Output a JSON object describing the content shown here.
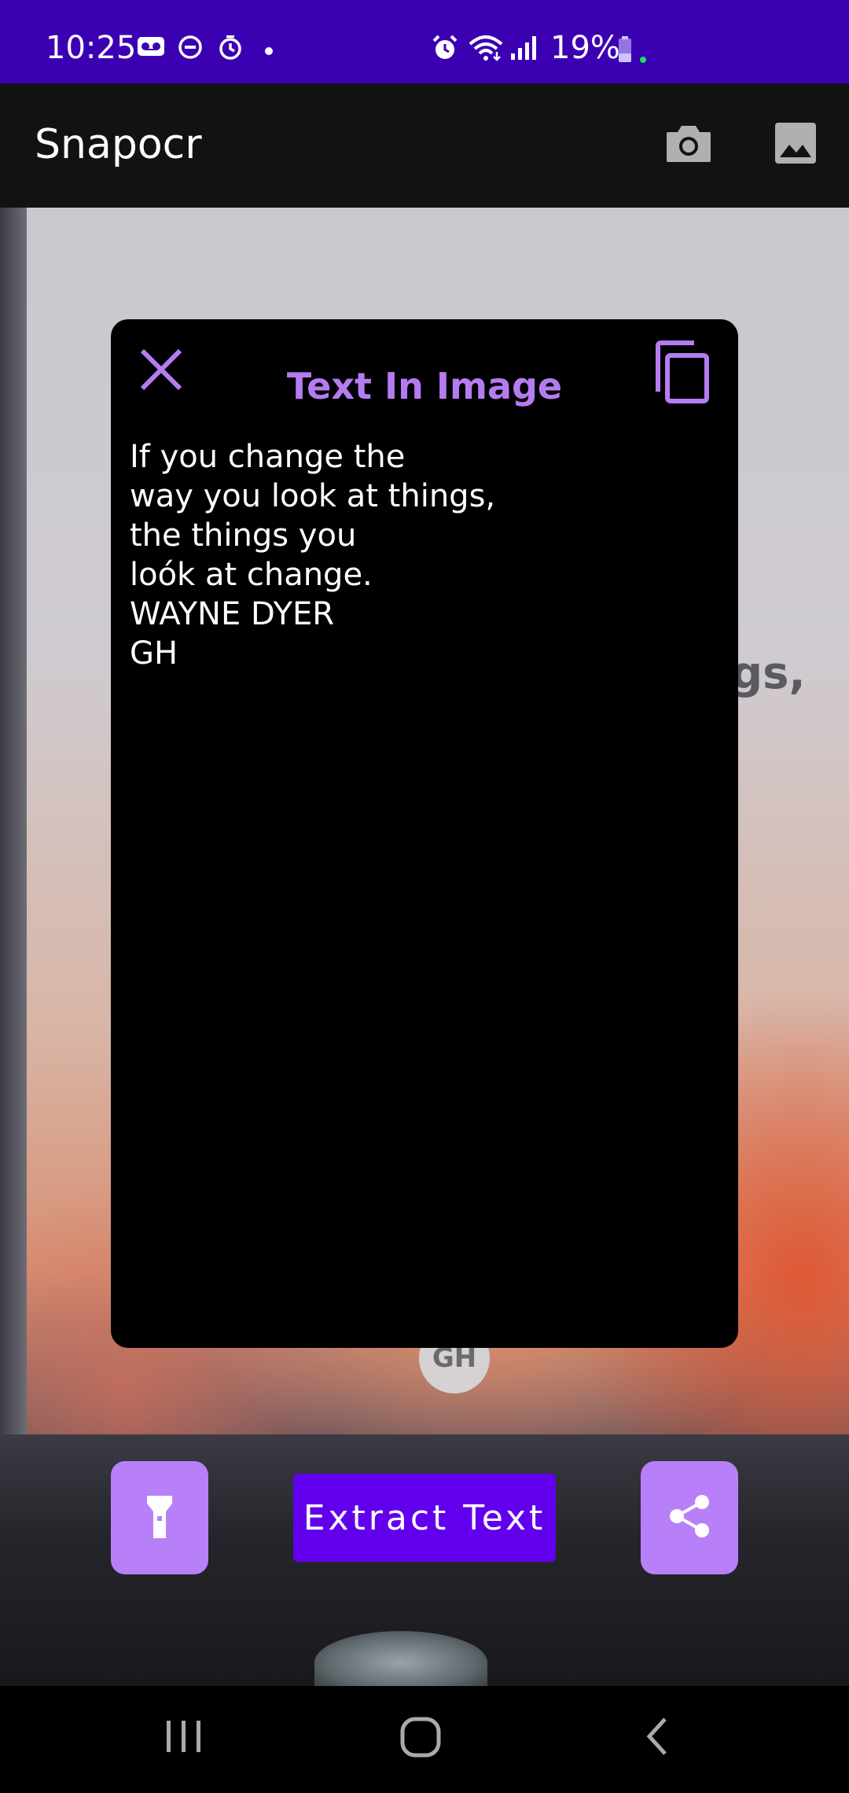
{
  "status_bar": {
    "time": "10:25",
    "battery_percent": "19%",
    "icons": [
      "voicemail-icon",
      "do-not-disturb-icon",
      "timer-icon",
      "dot-icon",
      "alarm-icon",
      "wifi-icon",
      "signal-icon",
      "battery-icon"
    ]
  },
  "app_bar": {
    "title": "Snapocr",
    "actions": [
      "camera-icon",
      "gallery-icon"
    ]
  },
  "preview": {
    "visible_text": "gs,",
    "badge_text": "GH"
  },
  "dialog": {
    "title": "Text In Image",
    "extracted_text": "If you change the\nway you look at things,\nthe things you\nloók at change.\nWAYNE DYER\nGH",
    "accent_color": "#b57cf2"
  },
  "actions": {
    "extract_label": "Extract Text",
    "flashlight": "flashlight-icon",
    "share": "share-icon",
    "button_color": "#6200ee",
    "fab_color": "#b880f8"
  },
  "nav_bar": {
    "buttons": [
      "recent-apps",
      "home",
      "back"
    ]
  }
}
